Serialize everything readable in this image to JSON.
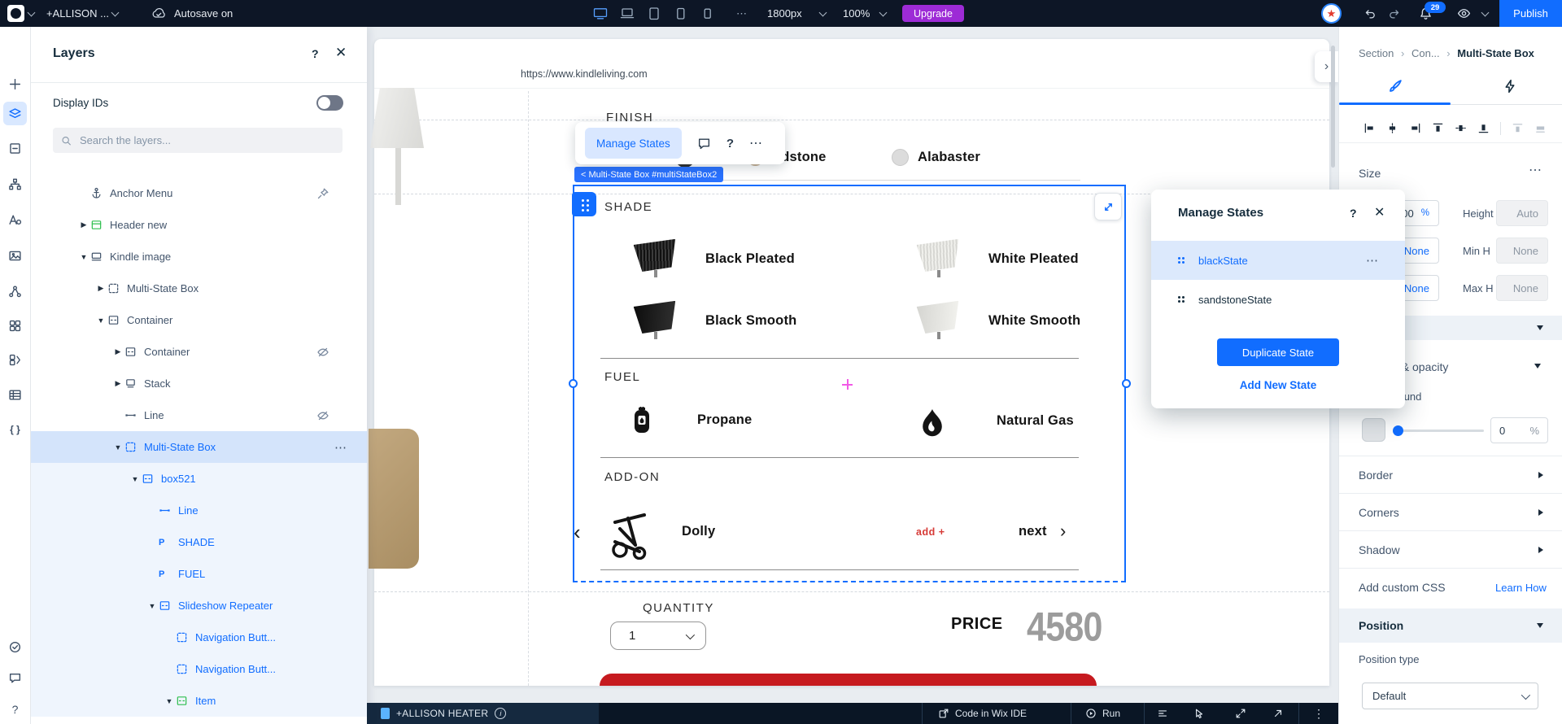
{
  "topbar": {
    "site_name": "+ALLISON ...",
    "autosave_label": "Autosave on",
    "breakpoint": "1800px",
    "zoom_level": "100%",
    "upgrade_label": "Upgrade",
    "publish_label": "Publish",
    "notification_count": "29",
    "device_icons": [
      "desktop-icon",
      "laptop-icon",
      "tablet-icon",
      "mobile-icon",
      "mobile-small-icon"
    ]
  },
  "left_rail": {
    "icons": [
      {
        "name": "add-elements-icon"
      },
      {
        "name": "layers-icon",
        "active": true
      },
      {
        "name": "pages-icon"
      },
      {
        "name": "sitemap-icon"
      },
      {
        "name": "typography-icon"
      },
      {
        "name": "media-icon"
      },
      {
        "name": "connections-icon"
      },
      {
        "name": "apps-icon"
      },
      {
        "name": "components-icon"
      },
      {
        "name": "cms-icon"
      },
      {
        "name": "code-icon"
      }
    ],
    "bottom_icons": [
      {
        "name": "checklist-icon"
      },
      {
        "name": "feedback-icon"
      },
      {
        "name": "help-icon"
      }
    ]
  },
  "layers_panel": {
    "title": "Layers",
    "help_label": "?",
    "display_ids_label": "Display IDs",
    "search_placeholder": "Search the layers...",
    "tree": [
      {
        "label": "Anchor Menu",
        "icon": "anchor-icon",
        "level": 0,
        "arrow": "none",
        "trailing": "pin-icon"
      },
      {
        "label": "Header new",
        "icon": "header-icon",
        "level": 0,
        "arrow": "right",
        "green": true
      },
      {
        "label": "Kindle image",
        "icon": "section-icon",
        "level": 0,
        "arrow": "down"
      },
      {
        "label": "Multi-State Box",
        "icon": "multistate-box-icon",
        "level": 1,
        "arrow": "right"
      },
      {
        "label": "Container",
        "icon": "container-icon",
        "level": 1,
        "arrow": "down"
      },
      {
        "label": "Container",
        "icon": "container-icon",
        "level": 2,
        "arrow": "right",
        "trailing": "hidden-icon"
      },
      {
        "label": "Stack",
        "icon": "stack-icon",
        "level": 2,
        "arrow": "right"
      },
      {
        "label": "Line",
        "icon": "line-icon",
        "level": 2,
        "arrow": "none",
        "trailing": "hidden-icon"
      },
      {
        "label": "Multi-State Box",
        "icon": "multistate-box-icon",
        "level": 2,
        "arrow": "down",
        "selected": true,
        "more": true
      },
      {
        "label": "box521",
        "icon": "container-icon",
        "level": 3,
        "arrow": "down",
        "tint": true
      },
      {
        "label": "Line",
        "icon": "line-icon",
        "level": 4,
        "arrow": "none",
        "tint": true
      },
      {
        "label": "SHADE",
        "icon": "text-p-icon",
        "level": 4,
        "arrow": "none",
        "tint": true
      },
      {
        "label": "FUEL",
        "icon": "text-p-icon",
        "level": 4,
        "arrow": "none",
        "tint": true
      },
      {
        "label": "Slideshow Repeater",
        "icon": "container-icon",
        "level": 4,
        "arrow": "down",
        "tint": true
      },
      {
        "label": "Navigation Butt...",
        "icon": "multistate-box-icon",
        "level": 5,
        "arrow": "none",
        "tint": true
      },
      {
        "label": "Navigation Butt...",
        "icon": "multistate-box-icon",
        "level": 5,
        "arrow": "none",
        "tint": true
      },
      {
        "label": "Item",
        "icon": "container-icon",
        "level": 5,
        "arrow": "down",
        "tint": true,
        "green": true
      }
    ]
  },
  "canvas": {
    "url": "https://www.kindleliving.com",
    "finish_label": "FINISH",
    "finish_option_partial": "ndstone",
    "finish_option_2": "Alabaster",
    "manage_states_label": "Manage States",
    "selection_breadcrumb": "< Multi-State Box #multiStateBox2",
    "shade": {
      "label": "SHADE",
      "options": [
        {
          "name": "Black Pleated",
          "swatch": "bp"
        },
        {
          "name": "White Pleated",
          "swatch": "wp"
        },
        {
          "name": "Black Smooth",
          "swatch": "bs"
        },
        {
          "name": "White Smooth",
          "swatch": "ws"
        }
      ]
    },
    "fuel": {
      "label": "FUEL",
      "options": [
        {
          "name": "Propane",
          "icon": "propane-tank-icon"
        },
        {
          "name": "Natural Gas",
          "icon": "flame-icon"
        }
      ]
    },
    "addon": {
      "label": "ADD-ON",
      "item": "Dolly",
      "add_label": "add +",
      "next_label": "next"
    },
    "quantity": {
      "label": "QUANTITY",
      "value": "1"
    },
    "price": {
      "label": "PRICE",
      "value": "4580"
    }
  },
  "manage_states_popup": {
    "title": "Manage States",
    "help_label": "?",
    "states": [
      {
        "label": "blackState",
        "selected": true
      },
      {
        "label": "sandstoneState"
      }
    ],
    "duplicate_label": "Duplicate State",
    "add_label": "Add New State"
  },
  "inspector": {
    "breadcrumb": {
      "0": "Section",
      "1": "Con...",
      "2": "Multi-State Box"
    },
    "size_label": "Size",
    "fields": {
      "width_value": "100",
      "width_unit": "%",
      "height_label": "Height",
      "height_value": "Auto",
      "min_w_value": "None",
      "min_h_label": "Min H",
      "min_h_value": "None",
      "max_w_value": "None",
      "max_h_label": "Max H",
      "max_h_value": "None"
    },
    "fill_section_label": "Fill & opacity",
    "background_label": "Background",
    "opacity_value": "0",
    "opacity_unit": "%",
    "design_rows": [
      {
        "label": "Border"
      },
      {
        "label": "Corners"
      },
      {
        "label": "Shadow"
      }
    ],
    "custom_css_label": "Add custom CSS",
    "learn_how_label": "Learn How",
    "position_section_label": "Position",
    "position_type_label": "Position type",
    "position_type_value": "Default"
  },
  "bottombar": {
    "site_label": "+ALLISON HEATER",
    "code_ide_label": "Code in Wix IDE",
    "run_label": "Run"
  },
  "colors": {
    "accent": "#116dff",
    "upgrade": "#9d2bd6",
    "danger": "#c61a1f",
    "price_gray": "#9c9c9c",
    "sandstone_swatch": "#c7b295",
    "alabaster_swatch": "#dcdcdc"
  }
}
